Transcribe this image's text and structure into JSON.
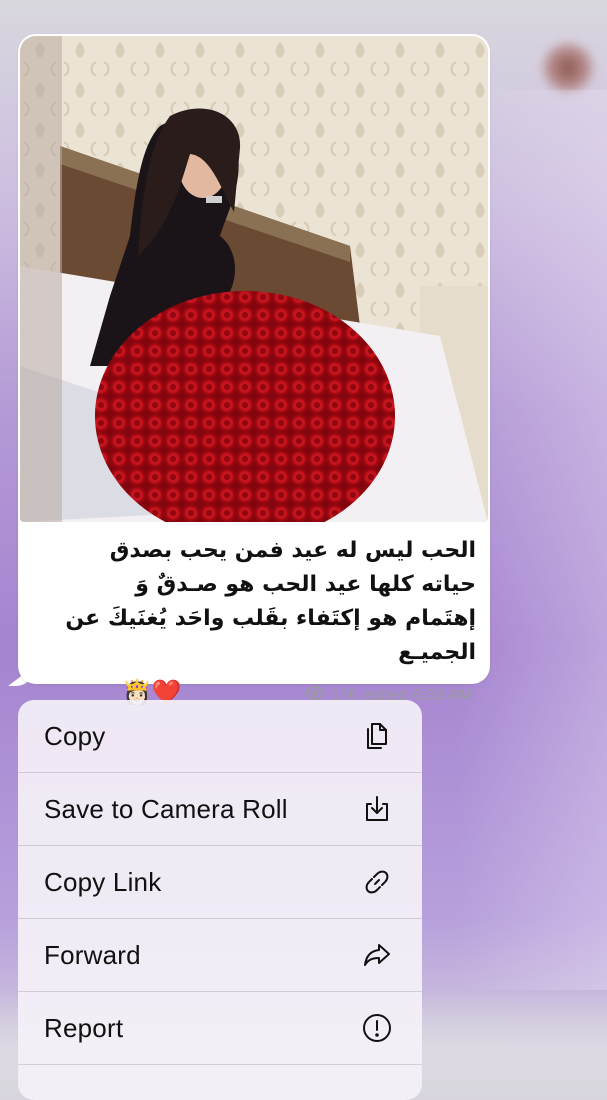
{
  "message": {
    "caption_lines": [
      "الحب ليس له عيد فمن يحب بصدق",
      "حياته كلها عيد الحب هو صـدقٌ وَ",
      "إهتَمام هو إكتَفاء بقَلب واحَد يُغنَيكَ عن",
      "الجميـع"
    ],
    "caption_emojis": "👸🏻❤️",
    "views": "176",
    "edited_label": "edited",
    "time": "6:33 AM"
  },
  "context_menu": {
    "items": [
      {
        "label": "Copy",
        "icon": "copy-icon"
      },
      {
        "label": "Save to Camera Roll",
        "icon": "save-icon"
      },
      {
        "label": "Copy Link",
        "icon": "link-icon"
      },
      {
        "label": "Forward",
        "icon": "forward-icon"
      },
      {
        "label": "Report",
        "icon": "report-icon"
      }
    ]
  },
  "colors": {
    "background_accent": "#a584d0",
    "bubble": "#ffffff",
    "meta_text": "#9a9aa0",
    "menu_background": "#f5f1f7"
  }
}
